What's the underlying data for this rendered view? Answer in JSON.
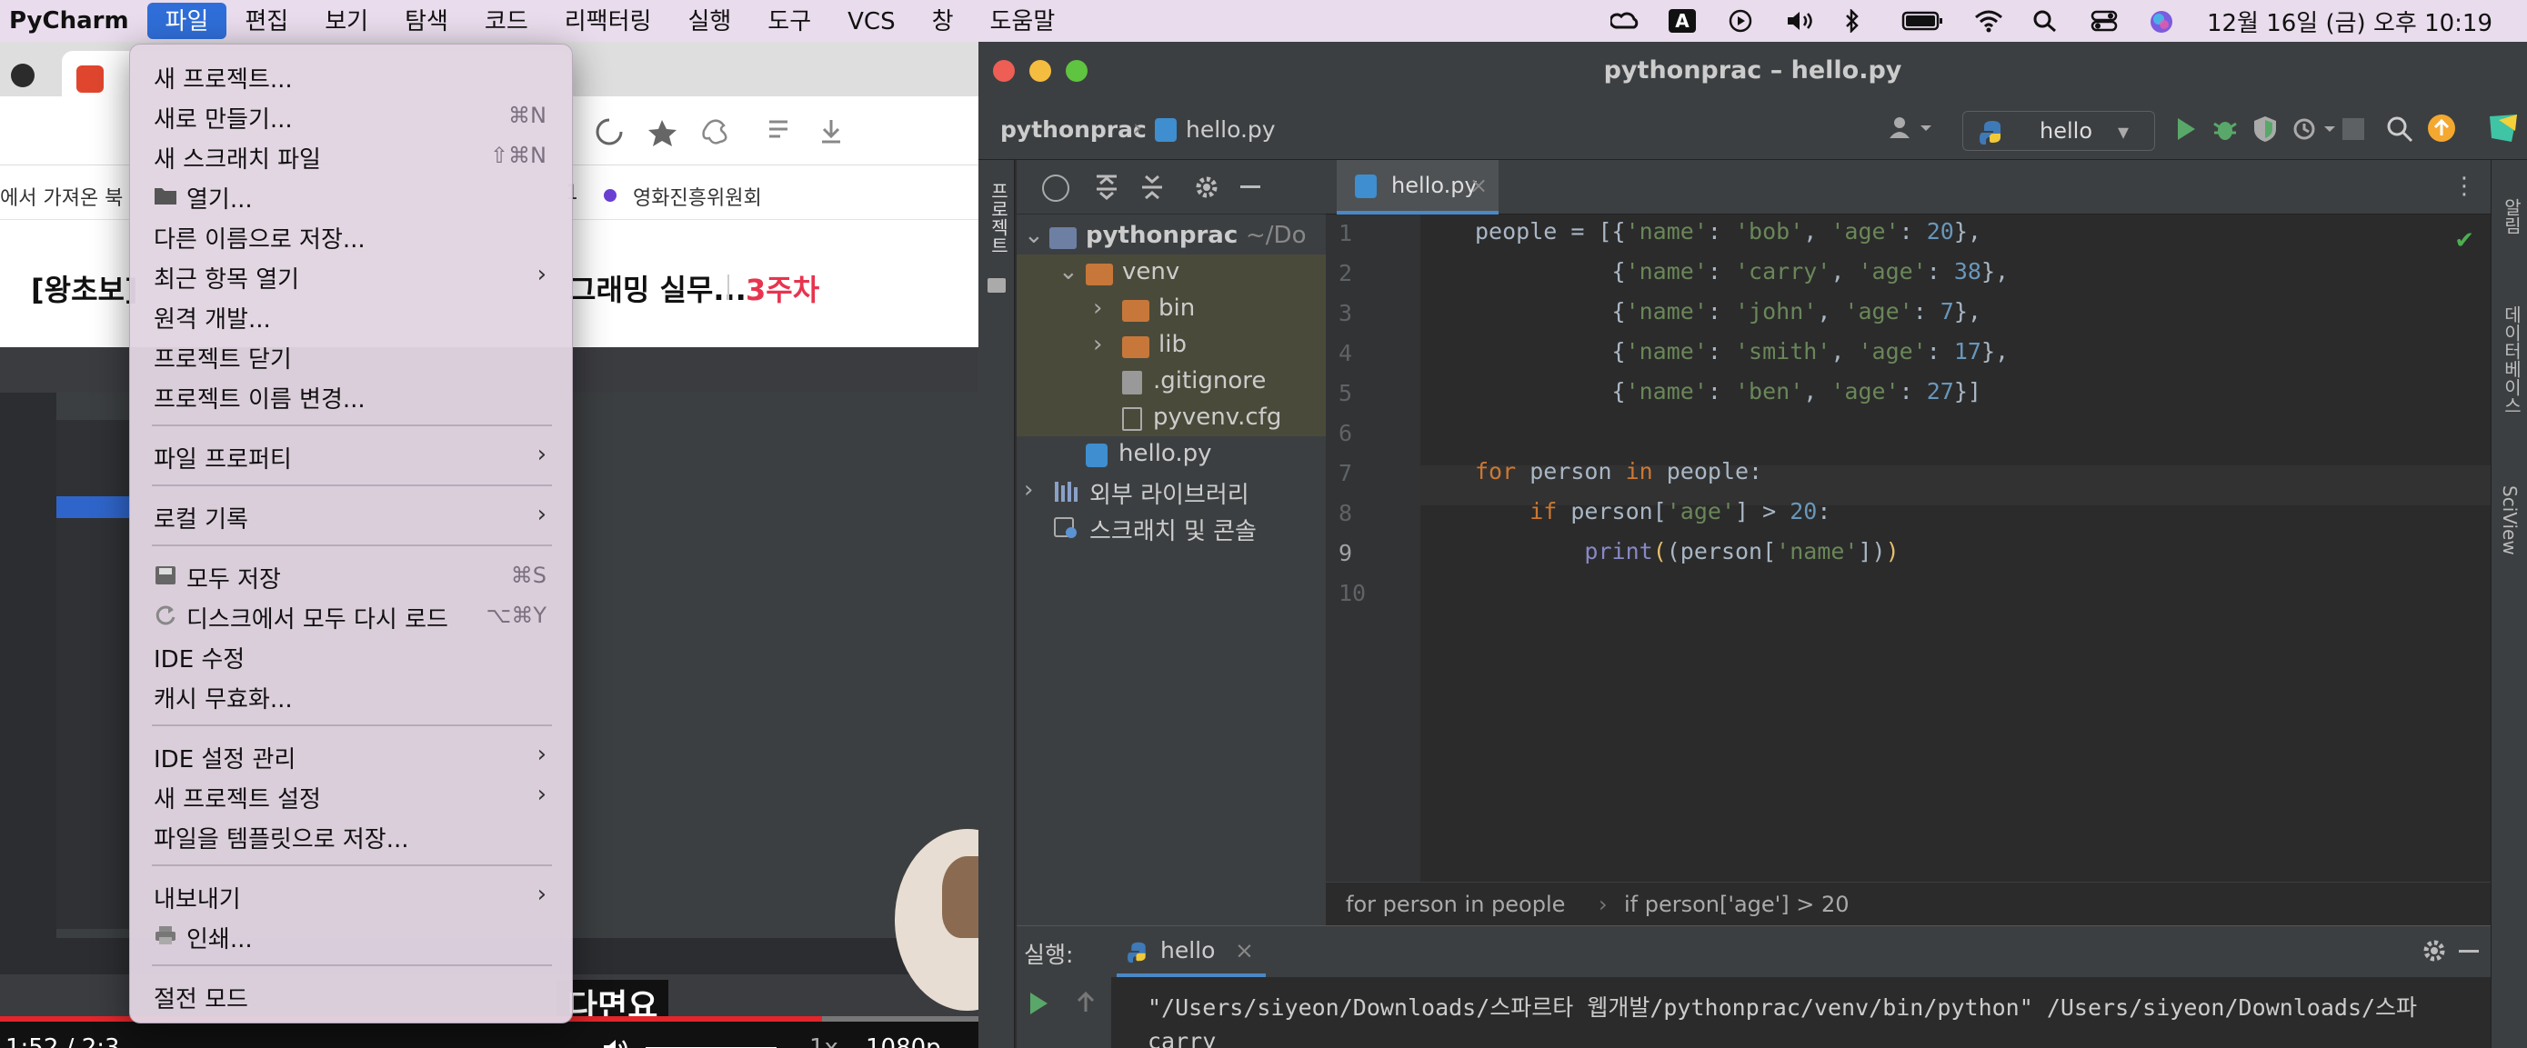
{
  "menubar": {
    "app": "PyCharm",
    "items": [
      "파일",
      "편집",
      "보기",
      "탐색",
      "코드",
      "리팩터링",
      "실행",
      "도구",
      "VCS",
      "창",
      "도움말"
    ],
    "clock": "12월 16일 (금) 오후 10:19",
    "status_icons": [
      "creative-cloud-icon",
      "input-source-icon",
      "play-icon",
      "volume-icon",
      "bluetooth-icon",
      "battery-icon",
      "wifi-icon",
      "spotlight-icon",
      "control-center-icon",
      "siri-icon"
    ],
    "input_source": "A"
  },
  "browser": {
    "bookmarks_left": "에서 가져온 북",
    "bookmarks_one": "1",
    "bookmarks_right": "영화진흥위원회",
    "course_left": "[왕초보]",
    "course_right": "그래밍 실무...",
    "course_week": "3주차",
    "subtitle": "다면요",
    "time_current": "1:52",
    "time_sep": "/",
    "time_total": "2:3",
    "speed": "1x",
    "quality": "1080p",
    "progress_fraction": 0.84
  },
  "file_menu": {
    "items": [
      {
        "label": "새 프로젝트...",
        "shortcut": "",
        "submenu": false
      },
      {
        "label": "새로 만들기...",
        "shortcut": "⌘N",
        "submenu": false
      },
      {
        "label": "새 스크래치 파일",
        "shortcut": "⇧⌘N",
        "submenu": false
      },
      {
        "label": "열기...",
        "shortcut": "",
        "submenu": false,
        "icon": "folder-icon"
      },
      {
        "label": "다른 이름으로 저장...",
        "shortcut": "",
        "submenu": false
      },
      {
        "label": "최근 항목 열기",
        "shortcut": "",
        "submenu": true
      },
      {
        "label": "원격 개발...",
        "shortcut": "",
        "submenu": false
      },
      {
        "label": "프로젝트 닫기",
        "shortcut": "",
        "submenu": false
      },
      {
        "label": "프로젝트 이름 변경...",
        "shortcut": "",
        "submenu": false
      },
      {
        "label": "파일 프로퍼티",
        "shortcut": "",
        "submenu": true
      },
      {
        "label": "로컬 기록",
        "shortcut": "",
        "submenu": true
      },
      {
        "label": "모두 저장",
        "shortcut": "⌘S",
        "submenu": false,
        "icon": "save-icon"
      },
      {
        "label": "디스크에서 모두 다시 로드",
        "shortcut": "⌥⌘Y",
        "submenu": false,
        "icon": "reload-icon"
      },
      {
        "label": "IDE 수정",
        "shortcut": "",
        "submenu": false
      },
      {
        "label": "캐시 무효화...",
        "shortcut": "",
        "submenu": false
      },
      {
        "label": "IDE 설정 관리",
        "shortcut": "",
        "submenu": true
      },
      {
        "label": "새 프로젝트 설정",
        "shortcut": "",
        "submenu": true
      },
      {
        "label": "파일을 템플릿으로 저장...",
        "shortcut": "",
        "submenu": false
      },
      {
        "label": "내보내기",
        "shortcut": "",
        "submenu": true
      },
      {
        "label": "인쇄...",
        "shortcut": "",
        "submenu": false,
        "icon": "print-icon"
      },
      {
        "label": "절전 모드",
        "shortcut": "",
        "submenu": false
      }
    ]
  },
  "pycharm": {
    "window_title": "pythonprac – hello.py",
    "breadcrumb_project": "pythonprac",
    "breadcrumb_file": "hello.py",
    "run_config": "hello",
    "left_strip_label": "프로젝트",
    "right_strip_labels": [
      "알림",
      "데이터베이스",
      "SciView"
    ],
    "project_tree": [
      {
        "label": "pythonprac",
        "suffix": "~/Do",
        "type": "folder",
        "expanded": true,
        "level": 0
      },
      {
        "label": "venv",
        "type": "folder",
        "expanded": true,
        "level": 1
      },
      {
        "label": "bin",
        "type": "folder",
        "expanded": false,
        "level": 2
      },
      {
        "label": "lib",
        "type": "folder",
        "expanded": false,
        "level": 2
      },
      {
        "label": ".gitignore",
        "type": "file",
        "level": 2
      },
      {
        "label": "pyvenv.cfg",
        "type": "file",
        "level": 2
      },
      {
        "label": "hello.py",
        "type": "python",
        "level": 1
      },
      {
        "label": "외부 라이브러리",
        "type": "library",
        "expanded": false,
        "level": 0
      },
      {
        "label": "스크래치 및 콘솔",
        "type": "scratch",
        "level": 0
      }
    ],
    "editor_tab": "hello.py",
    "line_numbers": [
      "1",
      "2",
      "3",
      "4",
      "5",
      "6",
      "7",
      "8",
      "9",
      "10"
    ],
    "current_line": 9,
    "code_breadcrumb": [
      "for person in people",
      "if person['age'] > 20"
    ],
    "run_label": "실행:",
    "run_tab": "hello",
    "run_output_line1": "\"/Users/siyeon/Downloads/스파르타 웹개발/pythonprac/venv/bin/python\" /Users/siyeon/Downloads/스파",
    "run_output_line2": "carry"
  }
}
